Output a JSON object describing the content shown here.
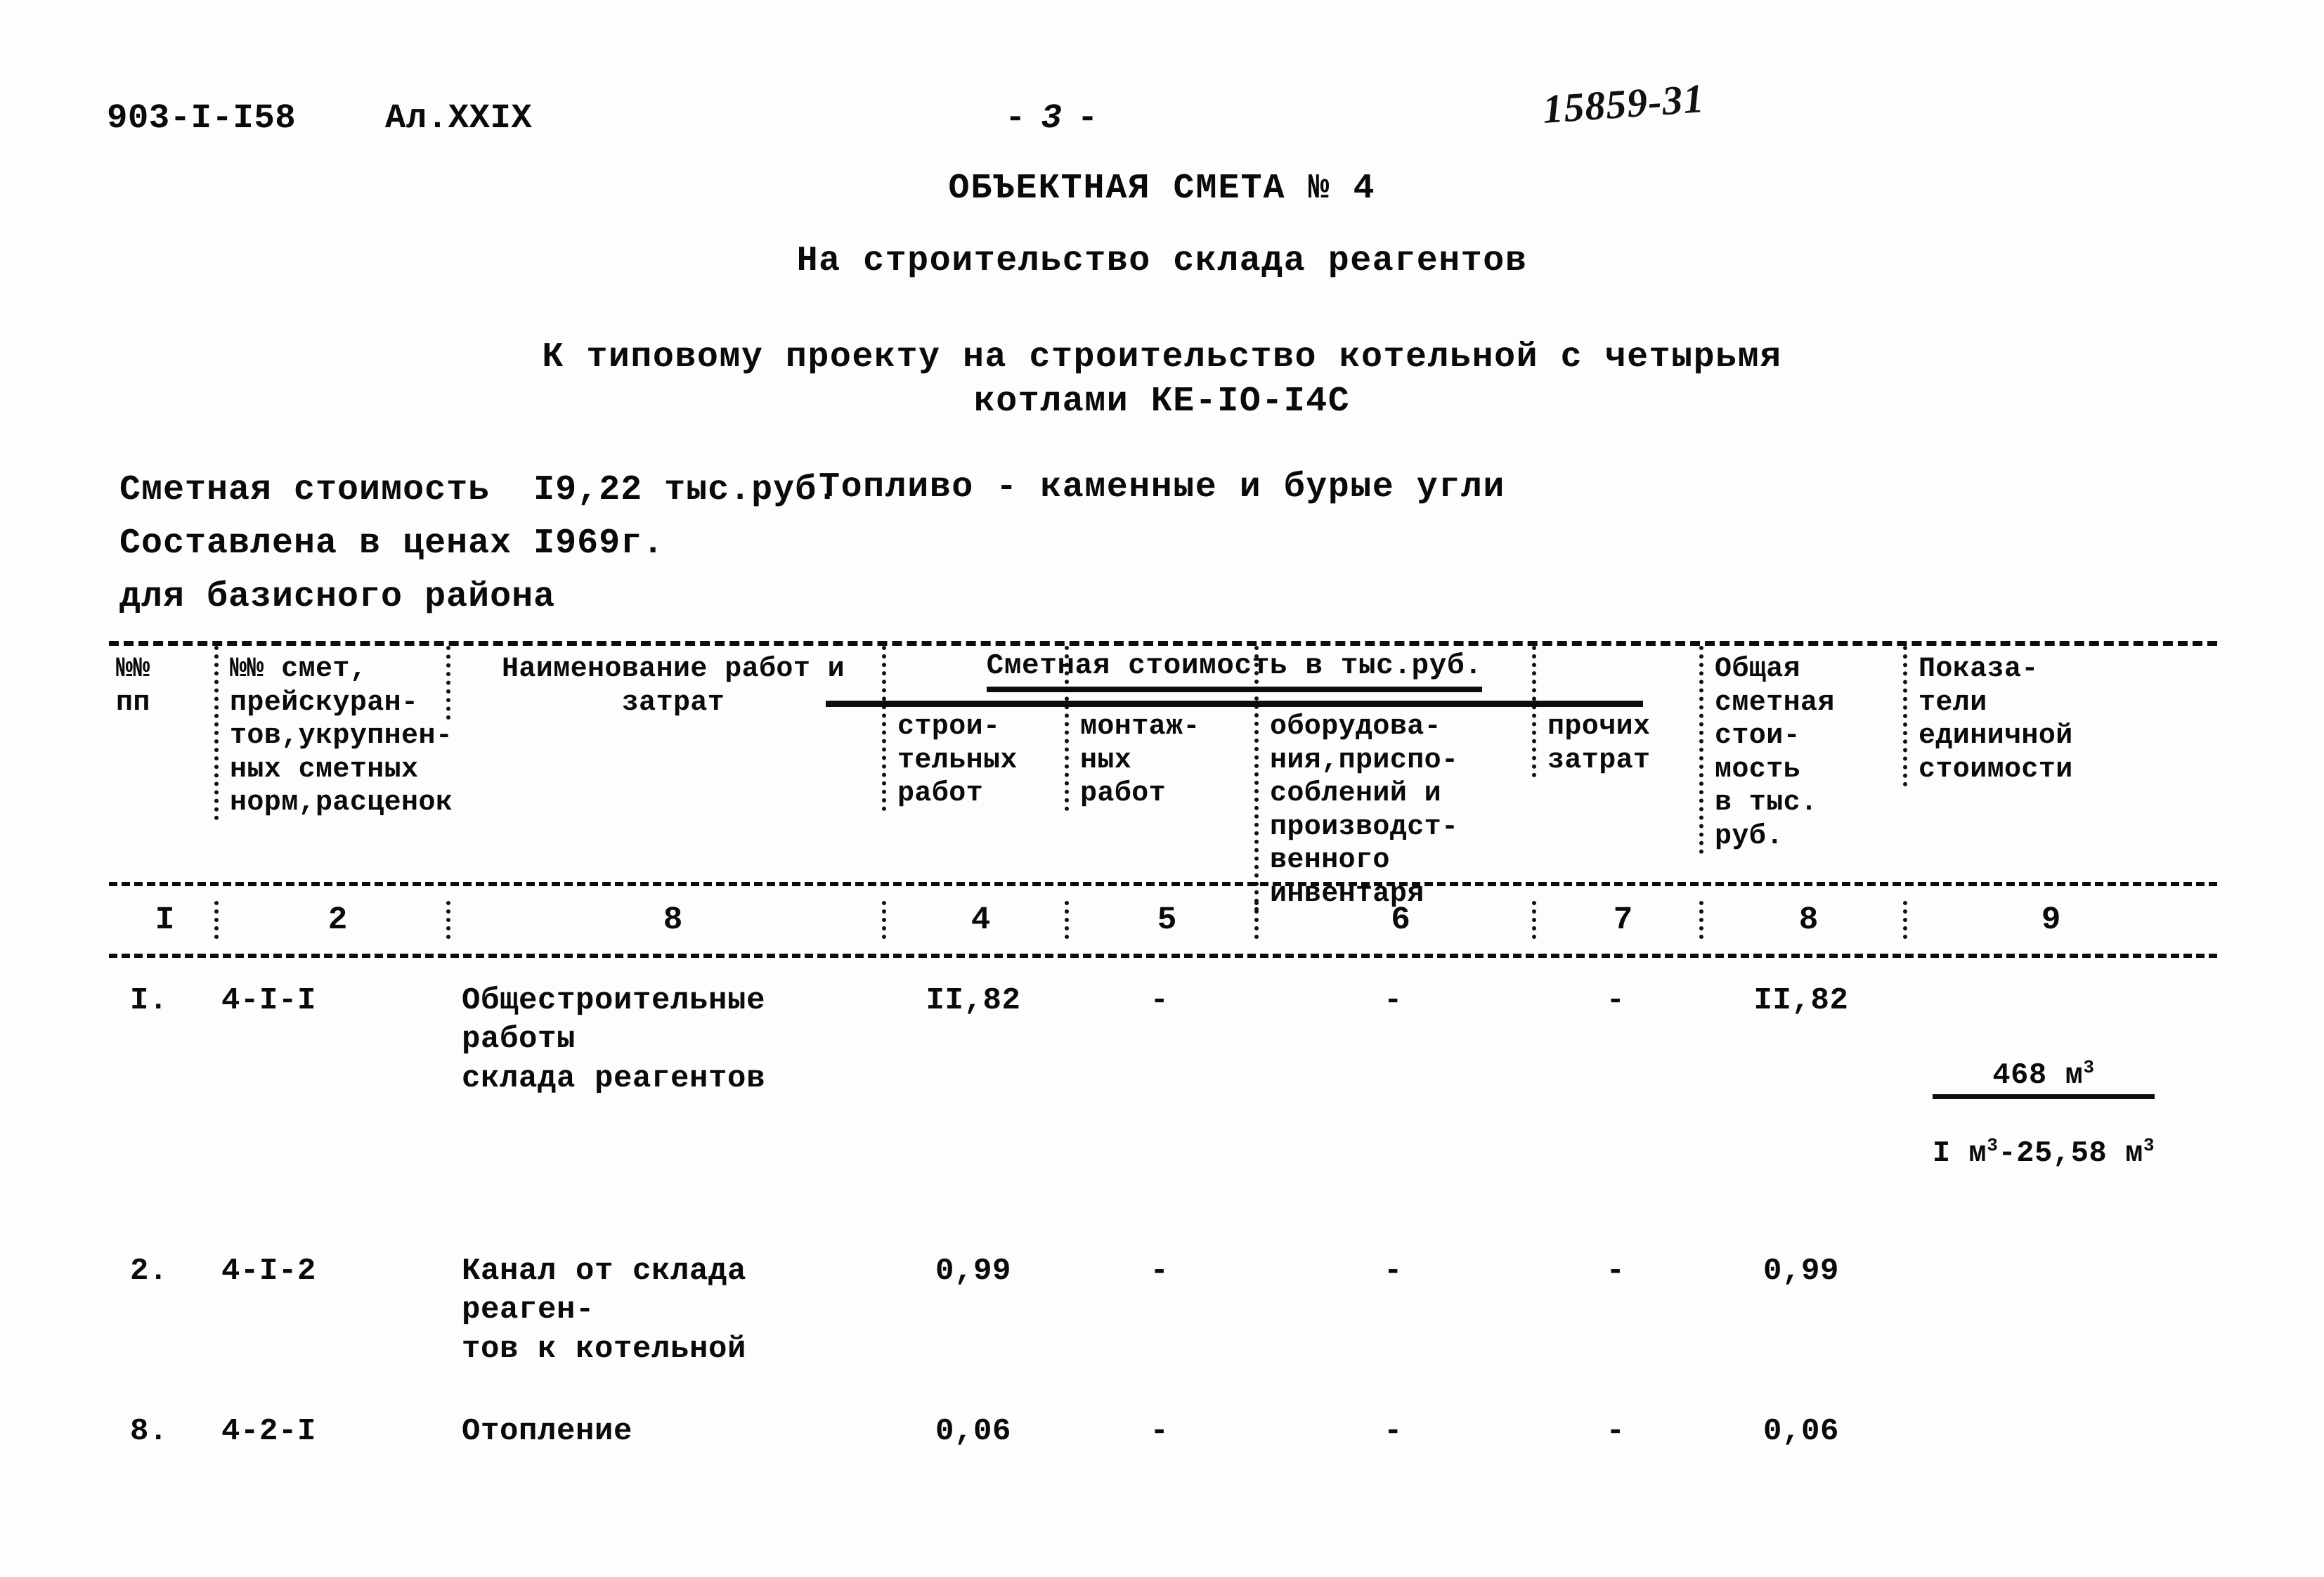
{
  "header": {
    "doc_code": "903-I-I58",
    "album_code": "Ал.XXIX",
    "page_label_left": "-",
    "page_number": "3",
    "page_label_right": "-",
    "stamp_number": "15859-31"
  },
  "title": {
    "main": "ОБЪЕКТНАЯ СМЕТА № 4",
    "subject": "На строительство склада реагентов",
    "project_line1": "К типовому проекту на строительство котельной с четырьмя",
    "project_line2": "котлами КЕ-IO-I4С",
    "fuel": "Топливо - каменные и бурые угли"
  },
  "summary": {
    "cost": "Сметная стоимость  I9,22 тыс.руб.",
    "prices": "Составлена в ценах I969г.",
    "region": "для базисного района"
  },
  "table": {
    "spanning_header": "Сметная стоимость в тыс.руб.",
    "columns": [
      {
        "title": "№№\nпп"
      },
      {
        "title": "№№ смет,\nпрейскуран-\nтов,укрупнен-\nных сметных\nнорм,расценок"
      },
      {
        "title": "Наименование работ и\nзатрат"
      },
      {
        "title": "строи-\nтельных\nработ"
      },
      {
        "title": "монтаж-\nных\nработ"
      },
      {
        "title": "оборудова-\nния,приспо-\nсоблений и\nпроизводст-\nвенного\nинвентаря"
      },
      {
        "title": "прочих\nзатрат"
      },
      {
        "title": "Общая\nсметная\nстои-\nмость\nв тыс.\nруб."
      },
      {
        "title": "Показа-\nтели\nединичной\nстоимости"
      }
    ],
    "column_numbers": [
      "I",
      "2",
      "8",
      "4",
      "5",
      "6",
      "7",
      "8",
      "9"
    ],
    "rows": [
      {
        "num": "I.",
        "code": "4-I-I",
        "name": "Общестроительные работы\nсклада реагентов",
        "construction": "II,82",
        "installation": "-",
        "equipment": "-",
        "other": "-",
        "total": "II,82",
        "unit_numerator": "468 м",
        "unit_numerator_sup": "3",
        "unit_denominator_pre": "I м",
        "unit_denominator_sup": "3",
        "unit_denominator_post": "-25,58 м",
        "unit_denominator_sup2": "3"
      },
      {
        "num": "2.",
        "code": "4-I-2",
        "name": "Канал от склада реаген-\nтов к котельной",
        "construction": "0,99",
        "installation": "-",
        "equipment": "-",
        "other": "-",
        "total": "0,99",
        "unit_numerator": "",
        "unit_numerator_sup": "",
        "unit_denominator_pre": "",
        "unit_denominator_sup": "",
        "unit_denominator_post": "",
        "unit_denominator_sup2": ""
      },
      {
        "num": "8.",
        "code": "4-2-I",
        "name": "Отопление",
        "construction": "0,06",
        "installation": "-",
        "equipment": "-",
        "other": "-",
        "total": "0,06",
        "unit_numerator": "",
        "unit_numerator_sup": "",
        "unit_denominator_pre": "",
        "unit_denominator_sup": "",
        "unit_denominator_post": "",
        "unit_denominator_sup2": ""
      }
    ]
  }
}
